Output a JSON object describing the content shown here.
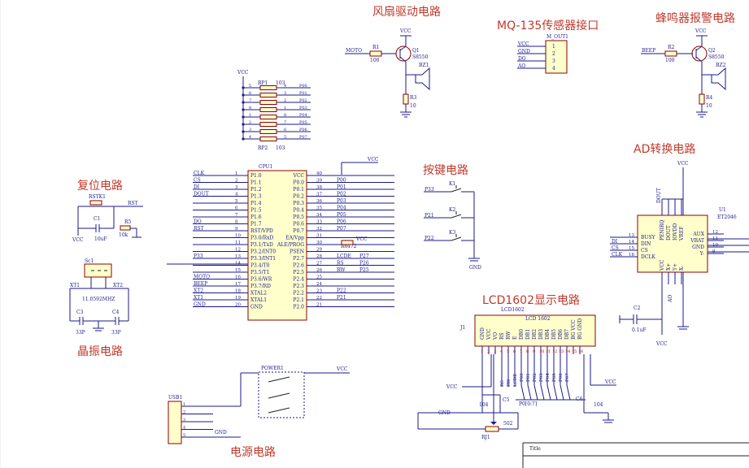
{
  "sections": {
    "fan": "风扇驱动电路",
    "mq135": "MQ-135传感器接口",
    "buzzer": "蜂鸣器报警电路",
    "reset": "复位电路",
    "keys": "按键电路",
    "ad": "AD转换电路",
    "crystal": "晶振电路",
    "lcd": "LCD1602显示电路",
    "power": "电源电路"
  },
  "fan": {
    "net": "MOTO",
    "r1": "R1",
    "r1v": "100",
    "q1": "Q1",
    "q1v": "S8550",
    "bz": "BZ1",
    "r3": "R3",
    "r3v": "10",
    "vcc": "VCC"
  },
  "buzzer": {
    "net": "BEEP",
    "r2": "R2",
    "r2v": "100",
    "q2": "Q2",
    "q2v": "S8550",
    "bz": "BZ2",
    "r4": "R4",
    "r4v": "10",
    "vcc": "VCC"
  },
  "mq": {
    "ref": "M_OUT1",
    "pins": [
      "VCC",
      "GND",
      "DO",
      "AO"
    ],
    "nums": [
      "1",
      "2",
      "3",
      "4"
    ]
  },
  "rp": {
    "vcc": "VCC",
    "rp1": "RP1",
    "rp1v": "103",
    "rp2": "RP2",
    "rp2v": "103",
    "left": [
      "5",
      "6",
      "7",
      "8",
      "1",
      "2",
      "3",
      "4"
    ],
    "right": [
      "4",
      "3",
      "2",
      "1",
      "8",
      "7",
      "6",
      "5"
    ],
    "nets": [
      "P00",
      "P01",
      "P02",
      "P03",
      "P04",
      "P05",
      "P06",
      "P07"
    ]
  },
  "cpu": {
    "ref": "CPU1",
    "vcc": "VCC",
    "leftNames": [
      "P1.0",
      "P1.1",
      "P1.2",
      "P1.3",
      "P1.4",
      "P1.5",
      "P1.6",
      "P1.7",
      "RST/VPD",
      "P3.0/RxD",
      "P3.1/TxD",
      "P3.2/INT0",
      "P3.3/INT1",
      "P3.4/T0",
      "P3.5/T1",
      "P3.6/WR",
      "P3.7/RD",
      "XTAL2",
      "XTAL1",
      "GND"
    ],
    "leftNums": [
      "1",
      "2",
      "3",
      "4",
      "5",
      "6",
      "7",
      "8",
      "9",
      "10",
      "11",
      "12",
      "13",
      "14",
      "15",
      "16",
      "17",
      "18",
      "19",
      "20"
    ],
    "leftNets": [
      "CLK",
      "CS",
      "DI",
      "DOUT",
      "",
      "",
      "",
      "DO",
      "RST",
      "",
      "",
      "",
      "P33",
      "",
      "",
      "MOTO",
      "BEEP",
      "XT2",
      "XT1",
      "GND"
    ],
    "rightNames": [
      "VCC",
      "P0.0",
      "P0.1",
      "P0.2",
      "P0.3",
      "P0.4",
      "P0.5",
      "P0.6",
      "P0.7",
      "EA/Vpp",
      "ALE/PROG",
      "PSEN",
      "P2.7",
      "P2.6",
      "P2.5",
      "P2.4",
      "P2.3",
      "P2.2",
      "P2.1",
      "P2.0"
    ],
    "rightNums": [
      "40",
      "39",
      "38",
      "37",
      "36",
      "35",
      "34",
      "33",
      "32",
      "31",
      "30",
      "29",
      "28",
      "27",
      "26",
      "25",
      "24",
      "23",
      "22",
      "21"
    ],
    "rightNets": [
      "",
      "P00",
      "P01",
      "P02",
      "P03",
      "P04",
      "P05",
      "P06",
      "P07",
      "",
      "",
      "",
      "LCDE",
      "RS",
      "RW",
      "",
      "",
      "P22",
      "P21",
      ""
    ],
    "rightNets2": [
      "",
      "",
      "",
      "",
      "",
      "",
      "",
      "",
      "",
      "",
      "",
      "",
      "P27",
      "P26",
      "P25",
      "",
      "",
      "",
      "",
      ""
    ],
    "r6": "R6",
    "r6v": "472",
    "vcc2": "VCC"
  },
  "reset": {
    "rstk": "RSTK1",
    "c1": "C1",
    "c1v": "10uF",
    "r5": "R5",
    "r5v": "10k",
    "net": "RST",
    "vcc": "VCC"
  },
  "crystal": {
    "ref": "Sc1",
    "freq": "11.0592MHZ",
    "c3": "C3",
    "c3v": "33P",
    "c4": "C4",
    "c4v": "33P",
    "xt1": "XT1",
    "xt2": "XT2"
  },
  "keys": {
    "k1": "K1",
    "k2": "K2",
    "k3": "K3",
    "n1": "P33",
    "n2": "P21",
    "n3": "P22",
    "gnd": "GND"
  },
  "ad": {
    "ref": "U1",
    "part": "ET2046",
    "vcc": "VCC",
    "leftPins": [
      "BUSY",
      "DIN",
      "CS",
      "DCLK"
    ],
    "leftNums": [
      "13",
      "14",
      "15",
      "16"
    ],
    "leftNets": [
      "DI",
      "CS",
      "CLK"
    ],
    "rightPins": [
      "AUX",
      "VBAT",
      "GND",
      "Y-"
    ],
    "rightNums": [
      "12",
      "11",
      "10",
      "9"
    ],
    "topPins": [
      "PENIRQ",
      "DOUT",
      "IOVDD",
      "VREF"
    ],
    "bottomPins": [
      "VCC",
      "X+",
      "Y+",
      "X-"
    ],
    "dout": "DOUT",
    "ao": "AO",
    "c2": "C2",
    "c2v": "0.1uF"
  },
  "lcd": {
    "ref": "J1",
    "part": "LCD1602",
    "label": "LCD 1602",
    "pins": [
      "GND",
      "VCC",
      "VO",
      "RS",
      "RW",
      "E",
      "DB0",
      "DB1",
      "DB2",
      "DB3",
      "DB4",
      "DB5",
      "DB6",
      "DB7",
      "BG VCC",
      "BG GND"
    ],
    "nums": [
      "1",
      "2",
      "3",
      "4",
      "5",
      "6",
      "7",
      "8",
      "9",
      "10",
      "11",
      "12",
      "13",
      "14",
      "15",
      "16"
    ],
    "bus": "P0[0:7]",
    "busnets": [
      "P00",
      "P01",
      "P02",
      "P03",
      "P04",
      "P05",
      "P06",
      "P07"
    ],
    "c5": "C5",
    "c5v": "104",
    "c6": "C6",
    "c6v": "104",
    "rj": "RJ1",
    "rjv": "502",
    "vcc": "VCC",
    "gnd": "GND",
    "rs": "RS",
    "rw": "RW",
    "e": "LCDE"
  },
  "power": {
    "sw": "POWER1",
    "usb": "USB1",
    "vcc": "VCC",
    "gnd": "GND",
    "usbnums": [
      "1",
      "2",
      "3",
      "4",
      "5"
    ]
  },
  "title": {
    "label": "Title"
  }
}
